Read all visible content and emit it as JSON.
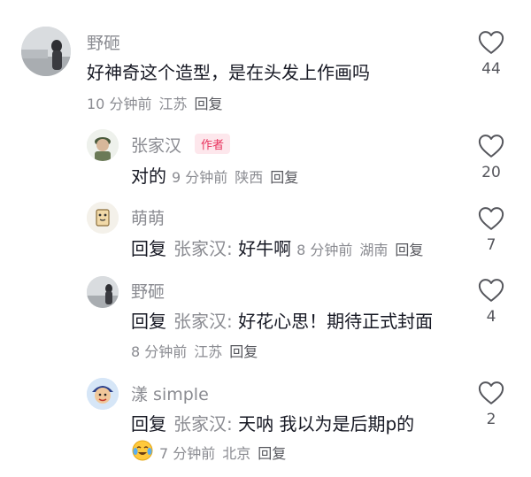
{
  "comments": [
    {
      "author": "野砸",
      "text": "好神奇这个造型，是在头发上作画吗",
      "time": "10 分钟前",
      "location": "江苏",
      "reply_label": "回复",
      "likes": "44"
    }
  ],
  "replies": [
    {
      "author": "张家汉",
      "badge": "作者",
      "text": "对的",
      "time": "9 分钟前",
      "location": "陕西",
      "reply_label": "回复",
      "likes": "20"
    },
    {
      "author": "萌萌",
      "prefix": "回复",
      "reply_to": "张家汉:",
      "text": "好牛啊",
      "time": "8 分钟前",
      "location": "湖南",
      "reply_label": "回复",
      "likes": "7"
    },
    {
      "author": "野砸",
      "prefix": "回复",
      "reply_to": "张家汉:",
      "text": "好花心思！期待正式封面",
      "time": "8 分钟前",
      "location": "江苏",
      "reply_label": "回复",
      "likes": "4"
    },
    {
      "author": "漾 simple",
      "prefix": "回复",
      "reply_to": "张家汉:",
      "text": "天呐 我以为是后期p的",
      "time": "7 分钟前",
      "location": "北京",
      "reply_label": "回复",
      "likes": "2"
    }
  ],
  "icons": {
    "like": "heart-outline-icon",
    "emoji": "crying-laughing-emoji-icon"
  },
  "colors": {
    "author_badge_text": "#e8335d",
    "author_badge_bg": "#fde7ec",
    "muted": "#8a8b91"
  }
}
